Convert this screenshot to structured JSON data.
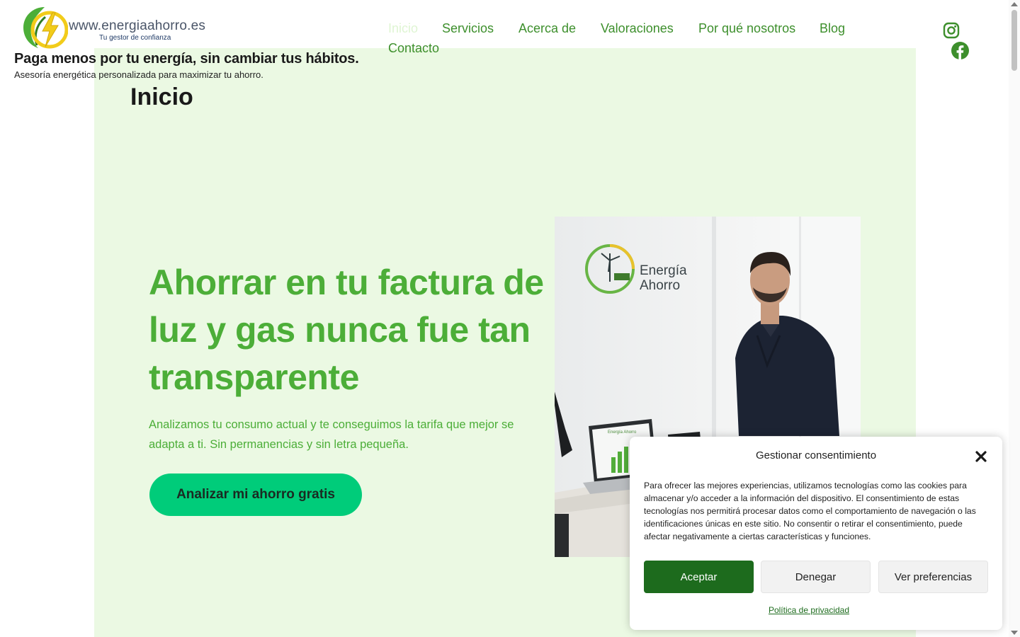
{
  "header": {
    "logo_text": "www.energiaahorro.es",
    "logo_tagline": "Tu gestor de confianza",
    "site_title": "Paga menos por tu energía, sin cambiar tus hábitos.",
    "site_description": "Asesoría energética personalizada para maximizar tu ahorro."
  },
  "nav": {
    "items": [
      {
        "label": "Inicio",
        "current": true
      },
      {
        "label": "Servicios"
      },
      {
        "label": "Acerca de"
      },
      {
        "label": "Valoraciones"
      },
      {
        "label": "Por qué nosotros"
      },
      {
        "label": "Blog"
      },
      {
        "label": "Contacto"
      }
    ]
  },
  "social": {
    "icons": [
      "instagram-icon",
      "facebook-icon"
    ]
  },
  "page": {
    "heading": "Inicio"
  },
  "hero": {
    "title": "Ahorrar en tu factura de luz y gas nunca fue tan transparente",
    "text": "Analizamos tu consumo actual y te conseguimos la tarifa que mejor se adapta a ti. Sin permanencias y sin letra pequeña.",
    "cta_label": "Analizar mi ahorro gratis"
  },
  "photo": {
    "wall_logo_line1": "Energía",
    "wall_logo_line2": "Ahorro",
    "laptop_label": "Energía Ahorro"
  },
  "consent": {
    "title": "Gestionar consentimiento",
    "body": "Para ofrecer las mejores experiencias, utilizamos tecnologías como las cookies para almacenar y/o acceder a la información del dispositivo. El consentimiento de estas tecnologías nos permitirá procesar datos como el comportamiento de navegación o las identificaciones únicas en este sitio. No consentir o retirar el consentimiento, puede afectar negativamente a ciertas características y funciones.",
    "accept_label": "Aceptar",
    "deny_label": "Denegar",
    "prefs_label": "Ver preferencias",
    "privacy_link": "Política de privacidad"
  },
  "colors": {
    "brand_green": "#4cae38",
    "nav_green": "#3d8f2c",
    "panel_bg": "#ebf9e3",
    "cta_bg": "#00cc7a",
    "accept_bg": "#1d6b1d"
  }
}
